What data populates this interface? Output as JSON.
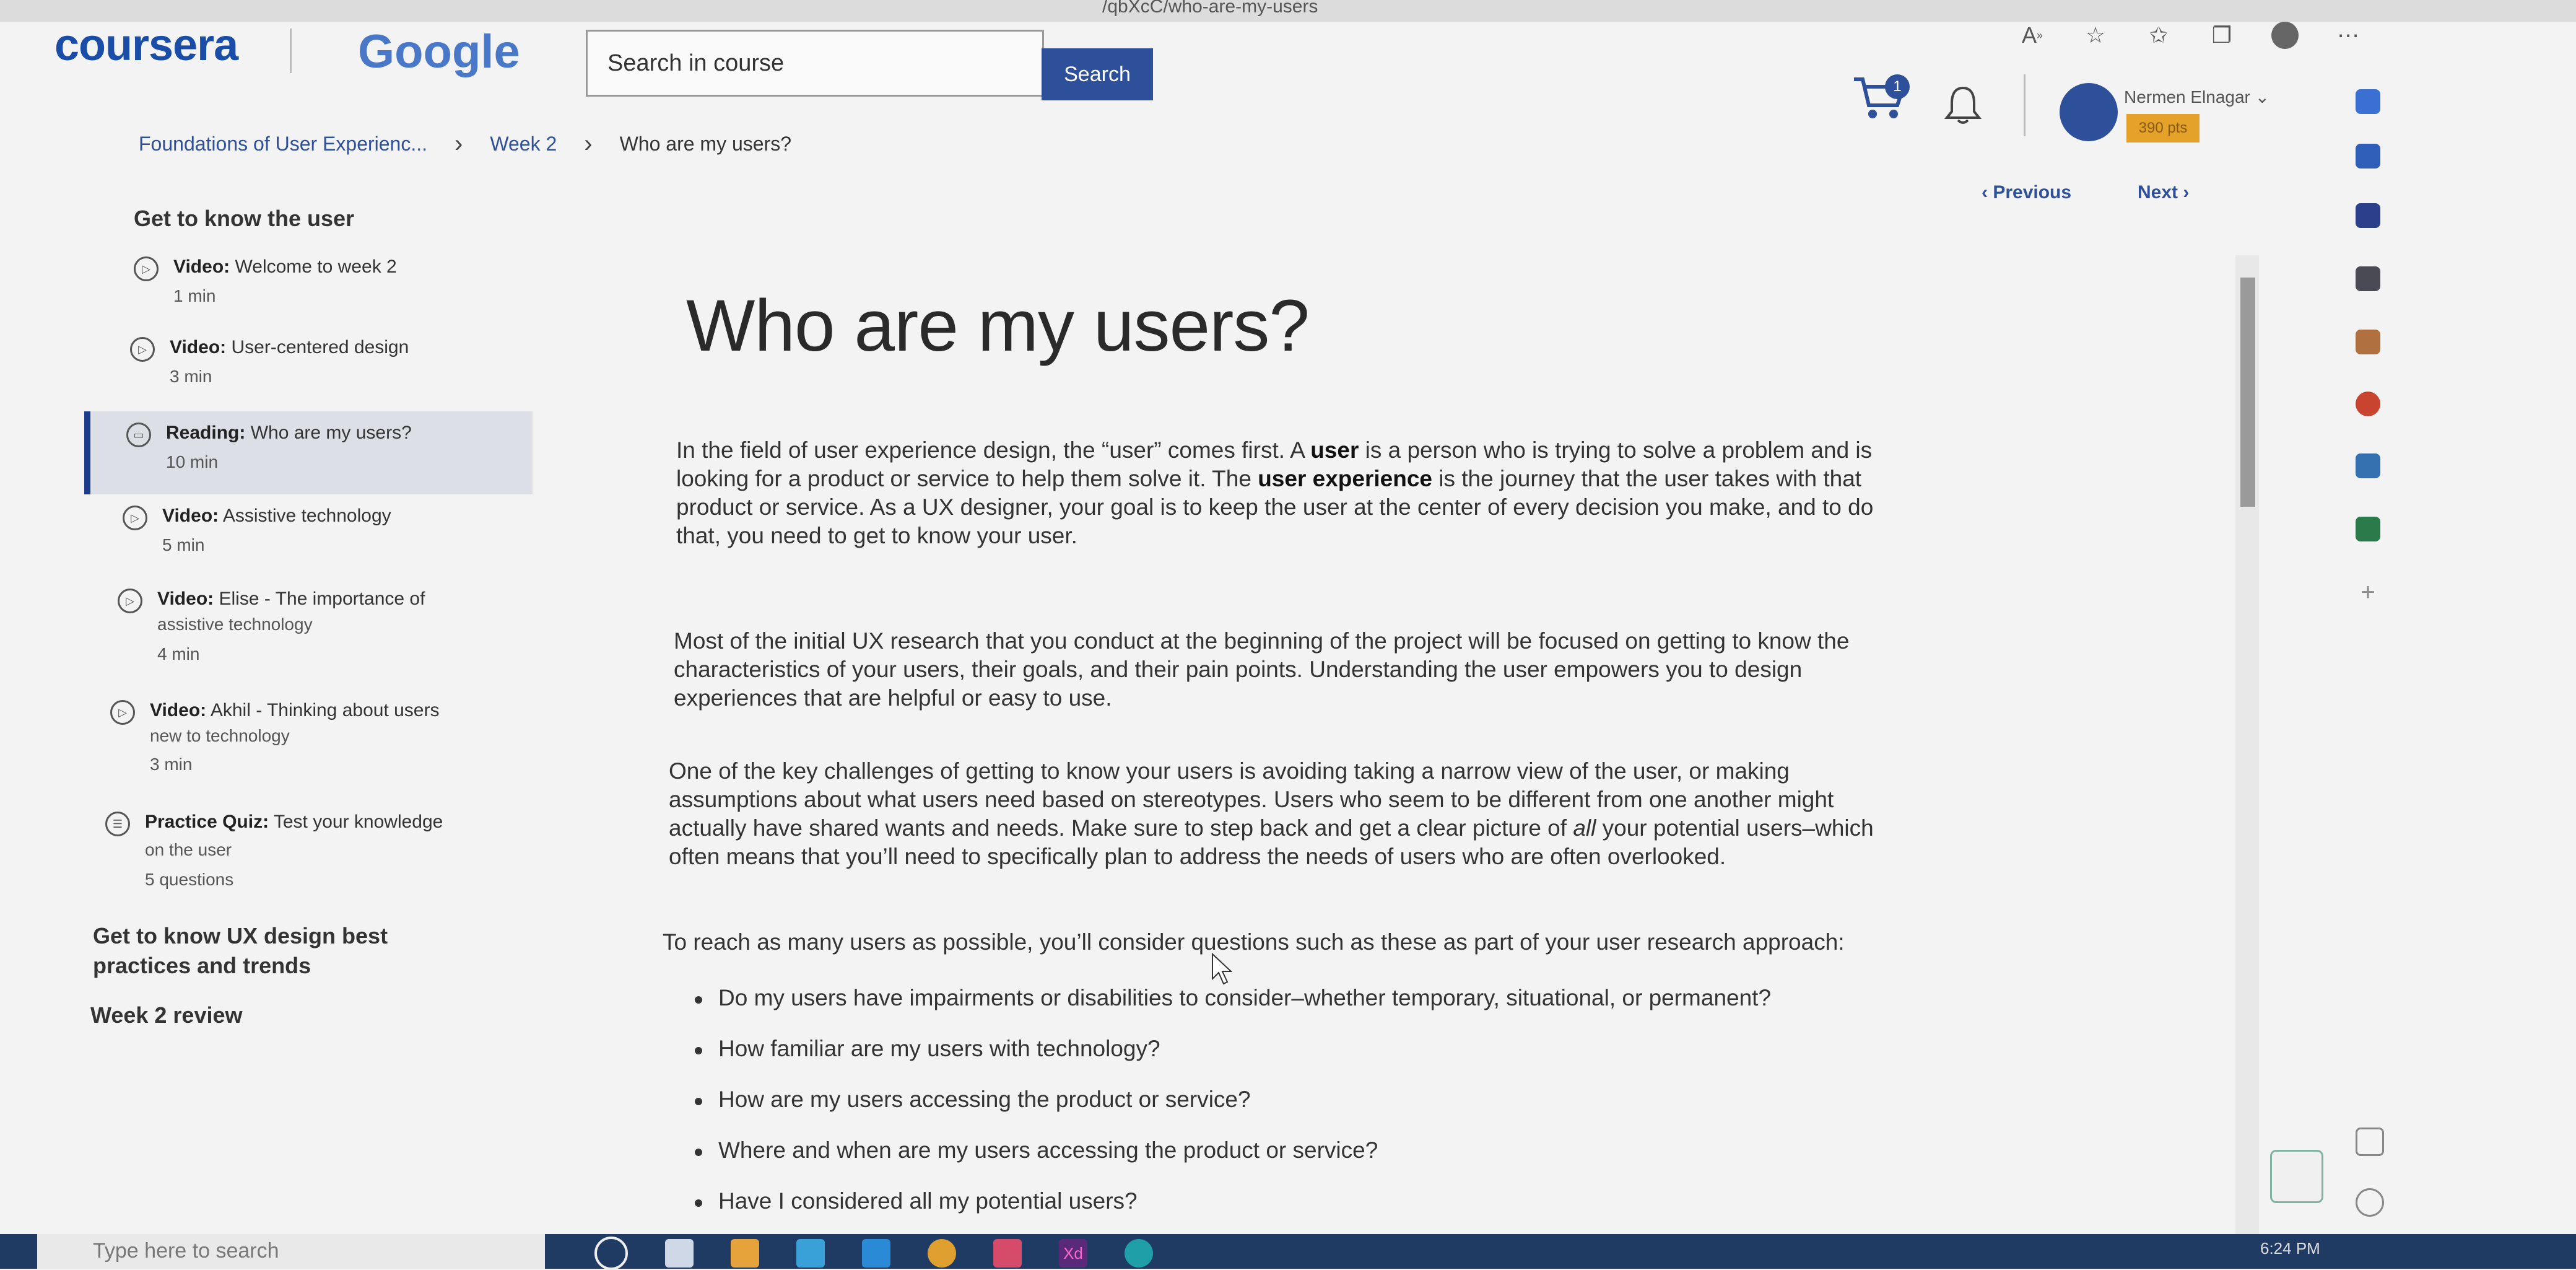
{
  "browser": {
    "url_fragment": "/qbXcC/who-are-my-users",
    "icons": [
      "read-aloud-icon",
      "favorite-add-icon",
      "favorites-icon",
      "collections-icon",
      "profile-icon",
      "more-icon"
    ]
  },
  "header": {
    "logo": "coursera",
    "partner": "Google",
    "search_placeholder": "Search in course",
    "search_button": "Search",
    "cart_count": "1",
    "user_name": "Nermen Elnagar",
    "xp": "390 pts"
  },
  "breadcrumb": {
    "course": "Foundations of User Experienc...",
    "week": "Week 2",
    "current": "Who are my users?"
  },
  "nav": {
    "previous": "Previous",
    "next": "Next"
  },
  "sidebar": {
    "section1": "Get to know the user",
    "items": [
      {
        "type": "Video:",
        "title": "Welcome to week 2",
        "title2": "",
        "meta": "1 min"
      },
      {
        "type": "Video:",
        "title": "User-centered design",
        "title2": "",
        "meta": "3 min"
      },
      {
        "type": "Reading:",
        "title": "Who are my users?",
        "title2": "",
        "meta": "10 min"
      },
      {
        "type": "Video:",
        "title": "Assistive technology",
        "title2": "",
        "meta": "5 min"
      },
      {
        "type": "Video:",
        "title": "Elise - The importance of",
        "title2": "assistive technology",
        "meta": "4 min"
      },
      {
        "type": "Video:",
        "title": "Akhil - Thinking about users",
        "title2": "new to technology",
        "meta": "3 min"
      },
      {
        "type": "Practice Quiz:",
        "title": "Test your knowledge",
        "title2": "on the user",
        "meta": "5 questions"
      }
    ],
    "section2_line1": "Get to know UX design best",
    "section2_line2": "practices and trends",
    "section3": "Week 2 review"
  },
  "content": {
    "title": "Who are my users?",
    "p1": {
      "l1a": "In the field of user experience design, the “user” comes first. A ",
      "l1b": "user",
      "l1c": " is a person who is trying to solve a problem and is",
      "l2a": "looking for a product or service to help them solve it. The ",
      "l2b": "user experience",
      "l2c": " is the journey that the user takes with that",
      "l3": "product or service. As a UX designer, your goal is to keep the user at the center of every decision you make, and to do",
      "l4": "that, you need to get to know your user."
    },
    "p2": [
      "Most of the initial UX research that you conduct at the beginning of the project will be focused on getting to know the",
      "characteristics of your users, their goals, and their pain points. Understanding the user empowers you to design",
      "experiences that are helpful or easy to use."
    ],
    "p3": {
      "l1": "One of the key challenges of getting to know your users is avoiding taking a narrow view of the user, or making",
      "l2": "assumptions about what users need based on stereotypes. Users who seem to be different from one another might",
      "l3a": "actually have shared wants and needs. Make sure to step back and get a clear picture of ",
      "l3b": "all",
      "l3c": " your potential users–which",
      "l4": "often means that you’ll need to specifically plan to address the needs of users who are often overlooked."
    },
    "p4": "To reach as many users as possible, you’ll consider questions such as these as part of your user research approach:",
    "bullets": [
      "Do my users have impairments or disabilities to consider–whether temporary, situational, or permanent?",
      "How familiar are my users with technology?",
      "How are my users accessing the product or service?",
      "Where and when are my users accessing the product or service?",
      "Have I considered all my potential users?"
    ]
  },
  "taskbar": {
    "search_placeholder": "Type here to search",
    "time": "6:24 PM"
  }
}
